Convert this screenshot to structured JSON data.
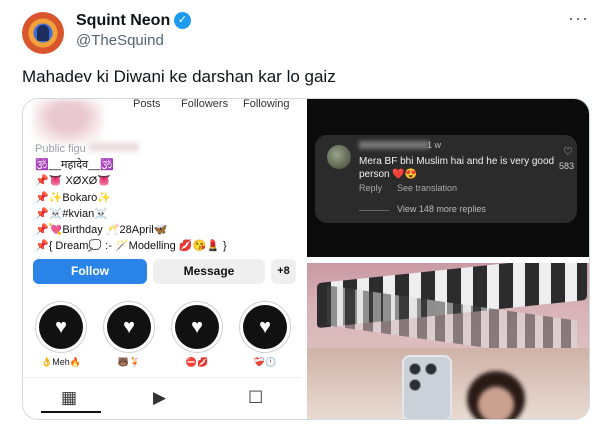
{
  "tweet": {
    "author_name": "Squint Neon",
    "handle": "@TheSquind",
    "more": "···",
    "text": "Mahadev ki Diwani ke darshan kar lo gaiz"
  },
  "profile": {
    "stats": [
      "Posts",
      "Followers",
      "Following"
    ],
    "public_figure": "Public figu",
    "bio_lines": [
      "🕉️__महादेव__🕉️",
      "📌👅 XØXØ👅",
      "📌✨Bokaro✨",
      "📌☠️#kvian☠️",
      "📌💘Birthday 🥂28April🦋",
      "📌{ Dream💭 :- 🪄Modelling 💋😘💄 }"
    ],
    "follow_label": "Follow",
    "message_label": "Message",
    "add_user_label": "+8",
    "highlights": [
      {
        "label": "👌Meh🔥"
      },
      {
        "label": "🐻🍹"
      },
      {
        "label": "⛔💋"
      },
      {
        "label": "❤️‍🩹🕛"
      }
    ],
    "tabs": [
      "grid-icon",
      "reels-icon",
      "tagged-icon"
    ]
  },
  "comment": {
    "time": "1 w",
    "text": "Mera BF bhi Muslim hai and he is very good person ❤️😍",
    "reply": "Reply",
    "see_translation": "See translation",
    "likes": "583",
    "view_more": "View 148 more replies"
  },
  "colors": {
    "verified": "#1d9bf0",
    "follow_button": "#2a84e8"
  }
}
